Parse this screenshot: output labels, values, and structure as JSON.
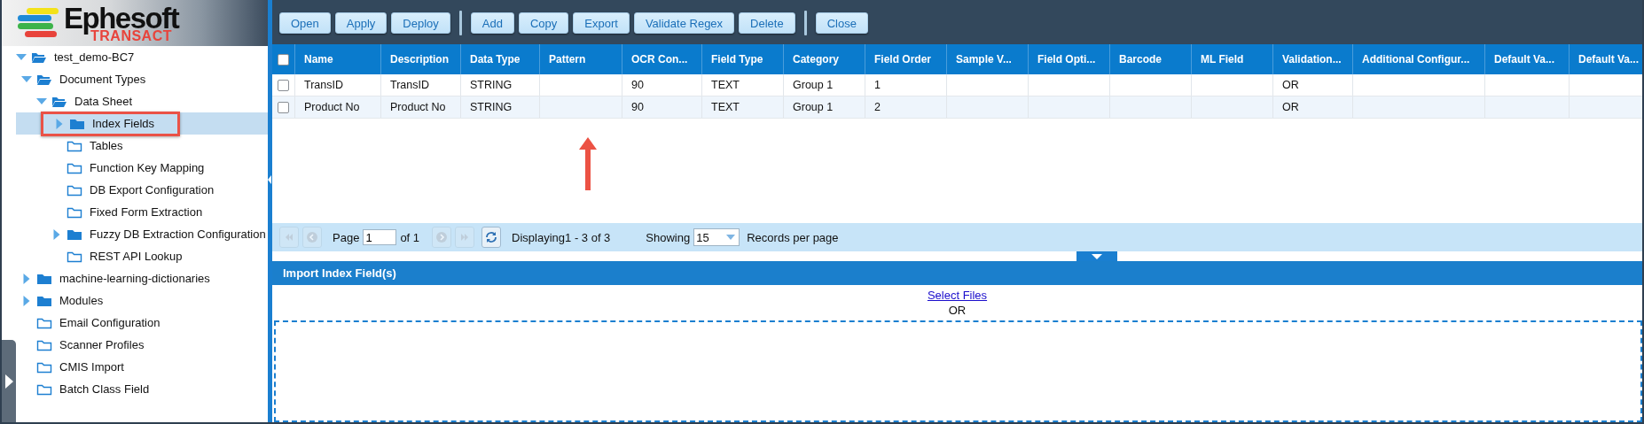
{
  "logo": {
    "name": "Ephesoft",
    "product": "TRANSACT"
  },
  "tree": [
    {
      "label": "test_demo-BC7",
      "expanded": true,
      "selected": false,
      "children": [
        {
          "label": "Document Types",
          "expanded": true,
          "selected": false,
          "children": [
            {
              "label": "Data Sheet",
              "expanded": true,
              "selected": false,
              "children": [
                {
                  "label": "Index Fields",
                  "expanded": false,
                  "selected": true
                },
                {
                  "label": "Tables",
                  "selected": false
                },
                {
                  "label": "Function Key Mapping",
                  "selected": false
                },
                {
                  "label": "DB Export Configuration",
                  "selected": false
                },
                {
                  "label": "Fixed Form Extraction",
                  "selected": false
                },
                {
                  "label": "Fuzzy DB Extraction Configuration",
                  "expanded": false,
                  "selected": false
                },
                {
                  "label": "REST API Lookup",
                  "selected": false
                }
              ]
            }
          ]
        },
        {
          "label": "machine-learning-dictionaries",
          "expanded": false,
          "selected": false
        },
        {
          "label": "Modules",
          "expanded": false,
          "selected": false
        },
        {
          "label": "Email Configuration",
          "selected": false
        },
        {
          "label": "Scanner Profiles",
          "selected": false
        },
        {
          "label": "CMIS Import",
          "selected": false
        },
        {
          "label": "Batch Class Field",
          "selected": false
        }
      ]
    }
  ],
  "toolbar_groups": [
    [
      "Open",
      "Apply",
      "Deploy"
    ],
    [
      "Add",
      "Copy",
      "Export",
      "Validate Regex",
      "Delete"
    ],
    [
      "Close"
    ]
  ],
  "grid": {
    "select_all_checked": false,
    "columns": [
      "Name",
      "Description",
      "Data Type",
      "Pattern",
      "OCR Con...",
      "Field Type",
      "Category",
      "Field Order",
      "Sample V...",
      "Field Opti...",
      "Barcode",
      "ML Field",
      "Validation...",
      "Additional Configur...",
      "Default Va...",
      "Default Va..."
    ],
    "rows": [
      {
        "checked": false,
        "cells": [
          "TransID",
          "TransID",
          "STRING",
          null,
          "90",
          "TEXT",
          "Group 1",
          "1",
          null,
          null,
          null,
          null,
          "OR",
          null,
          null,
          null
        ]
      },
      {
        "checked": false,
        "cells": [
          "Product No",
          "Product No",
          "STRING",
          null,
          "90",
          "TEXT",
          "Group 1",
          "2",
          null,
          null,
          null,
          null,
          "OR",
          null,
          null,
          null
        ]
      }
    ]
  },
  "pager": {
    "nav_before": [
      {
        "kind": "first",
        "disabled": true
      },
      {
        "kind": "prev",
        "disabled": true
      }
    ],
    "page_label": "Page",
    "page": "1",
    "of": "of 1",
    "nav_after": [
      {
        "kind": "next",
        "disabled": true
      },
      {
        "kind": "last",
        "disabled": true
      }
    ],
    "displaying": "Displaying1 - 3 of 3",
    "showing_label": "Showing",
    "page_size": "15",
    "records_label": "Records per page"
  },
  "import": {
    "title": "Import Index Field(s)",
    "link": "Select Files",
    "or": "OR"
  }
}
